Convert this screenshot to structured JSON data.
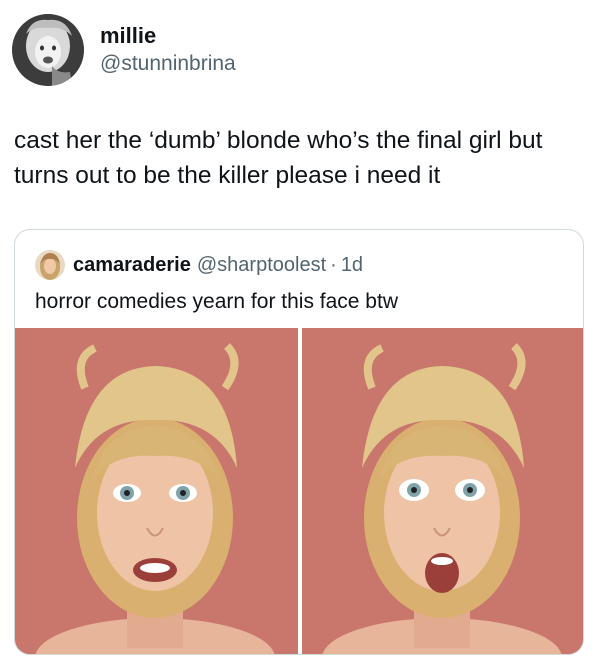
{
  "tweet": {
    "author": {
      "display_name": "millie",
      "handle": "@stunninbrina",
      "avatar_icon": "profile-photo"
    },
    "text": "cast her the ‘dumb’ blonde who’s the final girl but turns out to be the killer please i need it"
  },
  "quoted_tweet": {
    "author": {
      "display_name": "camaraderie",
      "handle": "@sharptoolest",
      "separator": "·",
      "time": "1d",
      "avatar_icon": "profile-photo"
    },
    "text": "horror comedies yearn for this face btw",
    "media": [
      {
        "name": "photo-left",
        "description_icon": "face-photo"
      },
      {
        "name": "photo-right",
        "description_icon": "face-photo"
      }
    ]
  },
  "colors": {
    "text_primary": "#0f1419",
    "text_secondary": "#536471",
    "border": "#cfd9de",
    "photo_background": "#c9776d"
  }
}
